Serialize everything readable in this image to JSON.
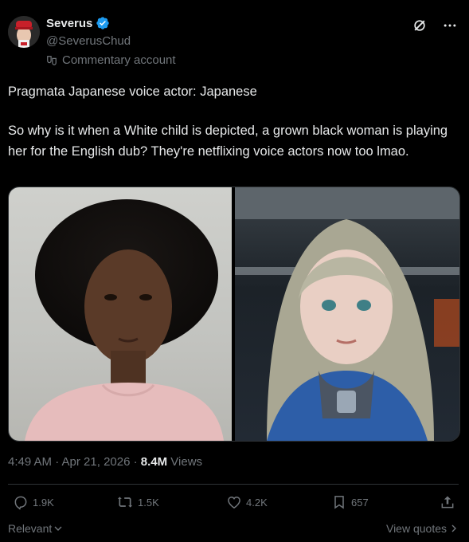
{
  "author": {
    "name": "Severus",
    "handle": "@SeverusChud",
    "badge": "Commentary account",
    "verified_color": "#1d9bf0"
  },
  "post": {
    "line1": "Pragmata Japanese voice actor: Japanese",
    "line2": "So why is it when a White child is depicted, a grown black woman is playing her for the English dub? They're netflixing voice actors now too lmao.",
    "time": "4:49 AM · Apr 21, 2026 · ",
    "views_count": "8.4M",
    "views_label": " Views"
  },
  "media": {
    "left_icon": "portrait-photo",
    "right_icon": "game-character-render"
  },
  "actions": {
    "replies": "1.9K",
    "reposts": "1.5K",
    "likes": "4.2K",
    "bookmarks": "657"
  },
  "footer": {
    "sort_label": "Relevant",
    "view_quotes": "View quotes"
  },
  "colors": {
    "background": "#000000",
    "text": "#e7e9ea",
    "muted": "#71767b",
    "border": "#2f3336"
  }
}
